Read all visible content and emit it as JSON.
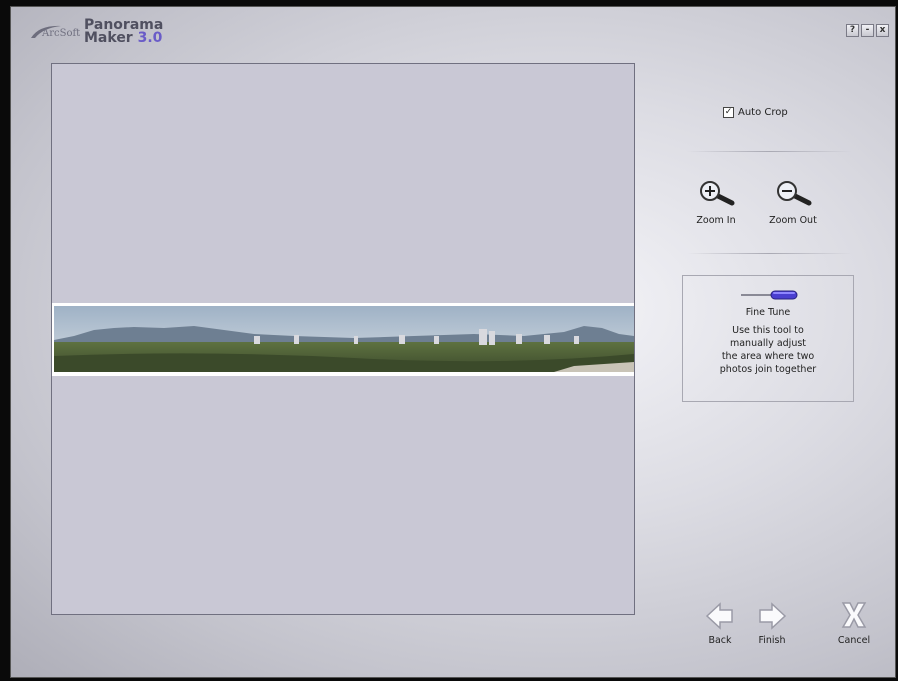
{
  "app": {
    "brand": "ArcSoft",
    "product_line1": "Panorama",
    "product_line2": "Maker",
    "version": "3.0"
  },
  "window_buttons": {
    "help": "?",
    "minimize": "-",
    "close": "x"
  },
  "options": {
    "auto_crop_label": "Auto Crop",
    "auto_crop_checked": true
  },
  "zoom": {
    "zoom_in_label": "Zoom In",
    "zoom_out_label": "Zoom Out"
  },
  "fine_tune": {
    "title": "Fine Tune",
    "line1": "Use this tool to",
    "line2": "manually adjust",
    "line3": "the area where two",
    "line4": "photos join together"
  },
  "nav": {
    "back_label": "Back",
    "finish_label": "Finish",
    "cancel_label": "Cancel"
  },
  "colors": {
    "accent": "#6a5cc8",
    "background": "#0a0a0a",
    "canvas": "#c9c8d5"
  }
}
